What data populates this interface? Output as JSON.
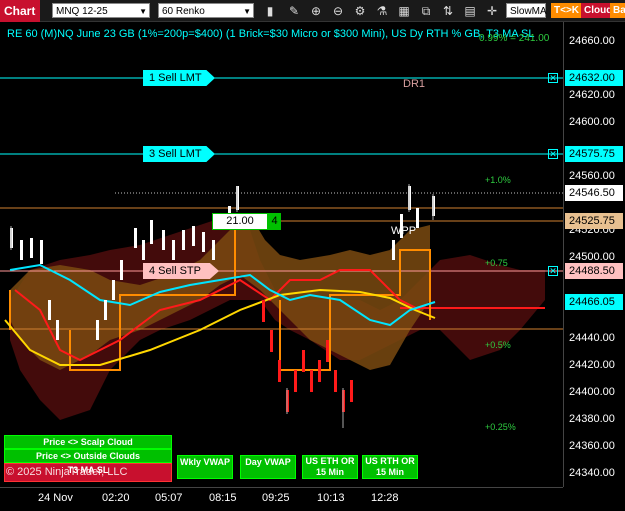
{
  "window": {
    "title": "Chart"
  },
  "toolbar": {
    "instrument": "MNQ 12-25",
    "period": "60 Renko",
    "indicator_select": "SlowMA",
    "tc_label": "T<>K",
    "cloud_label": "Cloud",
    "bar_label": "Ba",
    "icons": [
      "instrument-selector-icon",
      "bar-type-icon",
      "zoom-in-icon",
      "zoom-out-icon",
      "draw-tools-icon",
      "indicators-icon",
      "strategies-icon",
      "templates-icon",
      "chart-trader-icon",
      "properties-icon",
      "data-box-icon"
    ]
  },
  "header": {
    "text": "RE 60 (M)NQ June 23 GB (1%=200p=$400) (1 Brick=$30 Micro or $300 Mini), US Dy RTH % GB, T3 MA SL",
    "right_text": "0.99% = 241.00"
  },
  "orders": {
    "sell_lmt_1": "1 Sell LMT",
    "sell_lmt_3": "3 Sell LMT",
    "sell_stp_4": "4 Sell STP",
    "position_value": "21.00",
    "position_qty": "4"
  },
  "labels": {
    "dr1": "DR1",
    "wpp": "WPP"
  },
  "percent_labels": [
    "+1.0%",
    "+0.75",
    "+0.5%",
    "+0.25%"
  ],
  "price_axis": {
    "ticks": [
      "24660.00",
      "24640.00",
      "24620.00",
      "24600.00",
      "24580.00",
      "24560.00",
      "24540.00",
      "24520.00",
      "24500.00",
      "24480.00",
      "24460.00",
      "24440.00",
      "24420.00",
      "24400.00",
      "24380.00",
      "24360.00",
      "24340.00"
    ],
    "tags": {
      "sell_lmt_1": "24632.00",
      "sell_lmt_3": "24575.75",
      "last_price": "24546.50",
      "position": "24525.75",
      "sell_stp": "24488.50",
      "vwap": "24466.05"
    }
  },
  "time_axis": [
    "24 Nov",
    "02:20",
    "05:07",
    "08:15",
    "09:25",
    "10:13",
    "12:28"
  ],
  "buttons": {
    "scalp_cloud": "Price <> Scalp Cloud",
    "outside_clouds": "Price <> Outside Clouds",
    "t3_ma_sl": "T3 MA SL",
    "wkly_vwap": "Wkly VWAP",
    "day_vwap": "Day VWAP",
    "us_eth_or": "US ETH OR 15 Min",
    "us_rth_or": "US RTH OR 15 Min"
  },
  "copyright": "© 2025 NinjaTrader, LLC",
  "colors": {
    "cyan": "#00ffff",
    "up_bar": "#ffffff",
    "down_bar": "#ff1a1a",
    "button_green": "#00c000",
    "title_red": "#c8102e",
    "orange_cloud": "#b5651d"
  }
}
